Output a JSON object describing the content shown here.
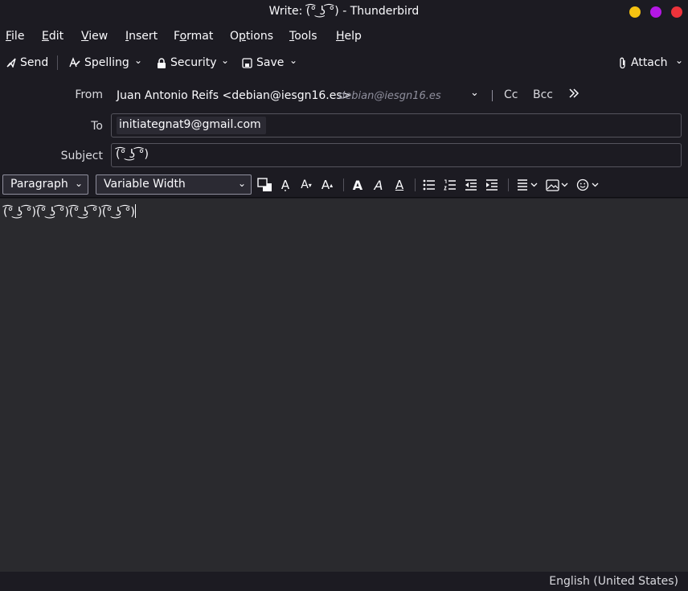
{
  "window": {
    "title": "Write: (͡° ͜ʖ ͡°) - Thunderbird",
    "buttons": {
      "minimize_color": "#f5c211",
      "maximize_color": "#b517e5",
      "close_color": "#ed333b"
    }
  },
  "menu": [
    {
      "label_pre": "",
      "accel": "F",
      "label_post": "ile"
    },
    {
      "label_pre": "",
      "accel": "E",
      "label_post": "dit"
    },
    {
      "label_pre": "",
      "accel": "V",
      "label_post": "iew"
    },
    {
      "label_pre": "",
      "accel": "I",
      "label_post": "nsert"
    },
    {
      "label_pre": "F",
      "accel": "o",
      "label_post": "rmat"
    },
    {
      "label_pre": "O",
      "accel": "p",
      "label_post": "tions"
    },
    {
      "label_pre": "",
      "accel": "T",
      "label_post": "ools"
    },
    {
      "label_pre": "",
      "accel": "H",
      "label_post": "elp"
    }
  ],
  "toolbar": {
    "send": "Send",
    "spelling": "Spelling",
    "security": "Security",
    "save": "Save",
    "attach": "Attach"
  },
  "header": {
    "from_label": "From",
    "from_value": "Juan Antonio Reifs <debian@iesgn16.es>",
    "from_hint": "debian@iesgn16.es",
    "cc": "Cc",
    "bcc": "Bcc",
    "to_label": "To",
    "to_value": "initiategnat9@gmail.com",
    "subject_label": "Subject",
    "subject_value": "(͡° ͜ʖ ͡°)"
  },
  "format": {
    "paragraph": "Paragraph",
    "font": "Variable Width"
  },
  "body": {
    "text": "(͡° ͜ʖ ͡°)(͡° ͜ʖ ͡°)(͡° ͜ʖ ͡°)(͡° ͜ʖ ͡°)"
  },
  "status": {
    "language": "English (United States)"
  }
}
